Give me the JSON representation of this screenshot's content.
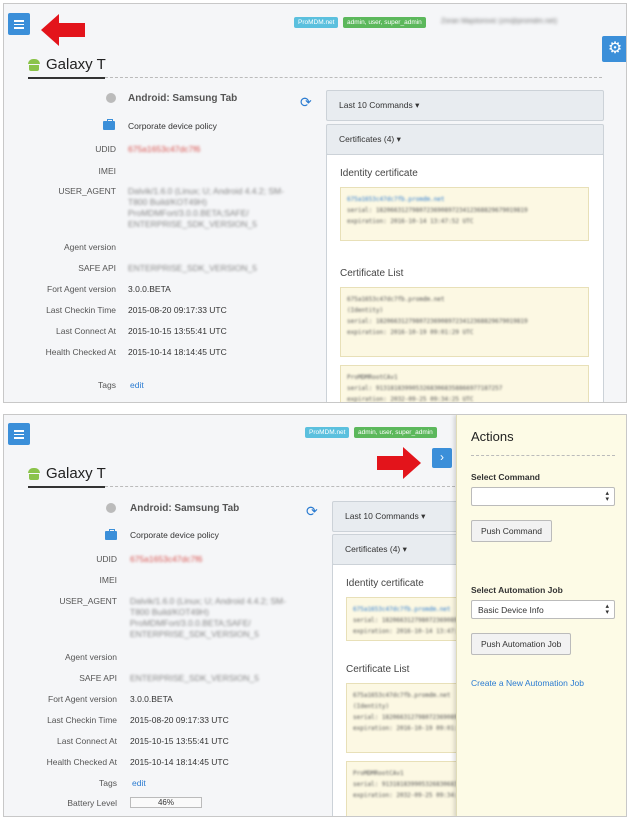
{
  "header": {
    "badges": [
      "ProMDM.net",
      "admin, user, super_admin"
    ],
    "user": "Zoran Majstorović (zm@promdm.net)"
  },
  "device": {
    "title": "Galaxy T",
    "model": "Android: Samsung Tab",
    "policy": "Corporate device policy"
  },
  "fields": [
    {
      "label": "UDID",
      "value": "675a1653c47dc7f6"
    },
    {
      "label": "IMEI",
      "value": ""
    },
    {
      "label": "USER_AGENT",
      "lines": [
        "Dalvik/1.6.0 (Linux; U; Android 4.4.2; SM-",
        "T800 Build/KOT49H)",
        "ProMDMFort/3.0.0.BETA;SAFE/",
        "ENTERPRISE_SDK_VERSION_5"
      ]
    },
    {
      "label": "Agent version",
      "value": ""
    },
    {
      "label": "SAFE API",
      "value": "ENTERPRISE_SDK_VERSION_5"
    },
    {
      "label": "Fort Agent version",
      "value": "3.0.0.BETA"
    },
    {
      "label": "Last Checkin Time",
      "value": "2015-08-20 09:17:33 UTC"
    },
    {
      "label": "Last Connect At",
      "value": "2015-10-15 13:55:41 UTC"
    },
    {
      "label": "Health Checked At",
      "value": "2015-10-14 18:14:45 UTC"
    },
    {
      "label": "Tags",
      "value": "edit"
    },
    {
      "label": "Battery Level",
      "value": "46%"
    }
  ],
  "battery_level": 0.46,
  "commands": {
    "last10": "Last 10 Commands",
    "certificates": "Certificates (4)",
    "identity_heading": "Identity certificate",
    "identity_lines": [
      "675a1653c47dc7fb.promdm.net",
      "serial: 182066312798072369089723412368829679019819",
      "expiration: 2016-10-14 13:47:52 UTC"
    ],
    "list_heading": "Certificate List",
    "cert1_lines": [
      "675a1653c47dc7fb.promdm.net",
      "(Identity)",
      "serial: 182066312798072369089723412368829679019819",
      "expiration: 2016-10-19 09:01:29 UTC"
    ],
    "cert2_lines": [
      "ProMDMRootCAv1",
      "serial: 91318183990532683068358866977187257",
      "expiration: 2032-09-25 09:34:25 UTC"
    ]
  },
  "actions": {
    "title": "Actions",
    "select_command_label": "Select Command",
    "select_command_value": "",
    "push_command": "Push Command",
    "select_job_label": "Select Automation Job",
    "select_job_value": "Basic Device Info",
    "push_job": "Push Automation Job",
    "create_job_link": "Create a New Automation Job"
  },
  "colors": {
    "accent": "#3b8fd9",
    "arrow": "#e3141b",
    "drawer": "#fdfbe6"
  }
}
